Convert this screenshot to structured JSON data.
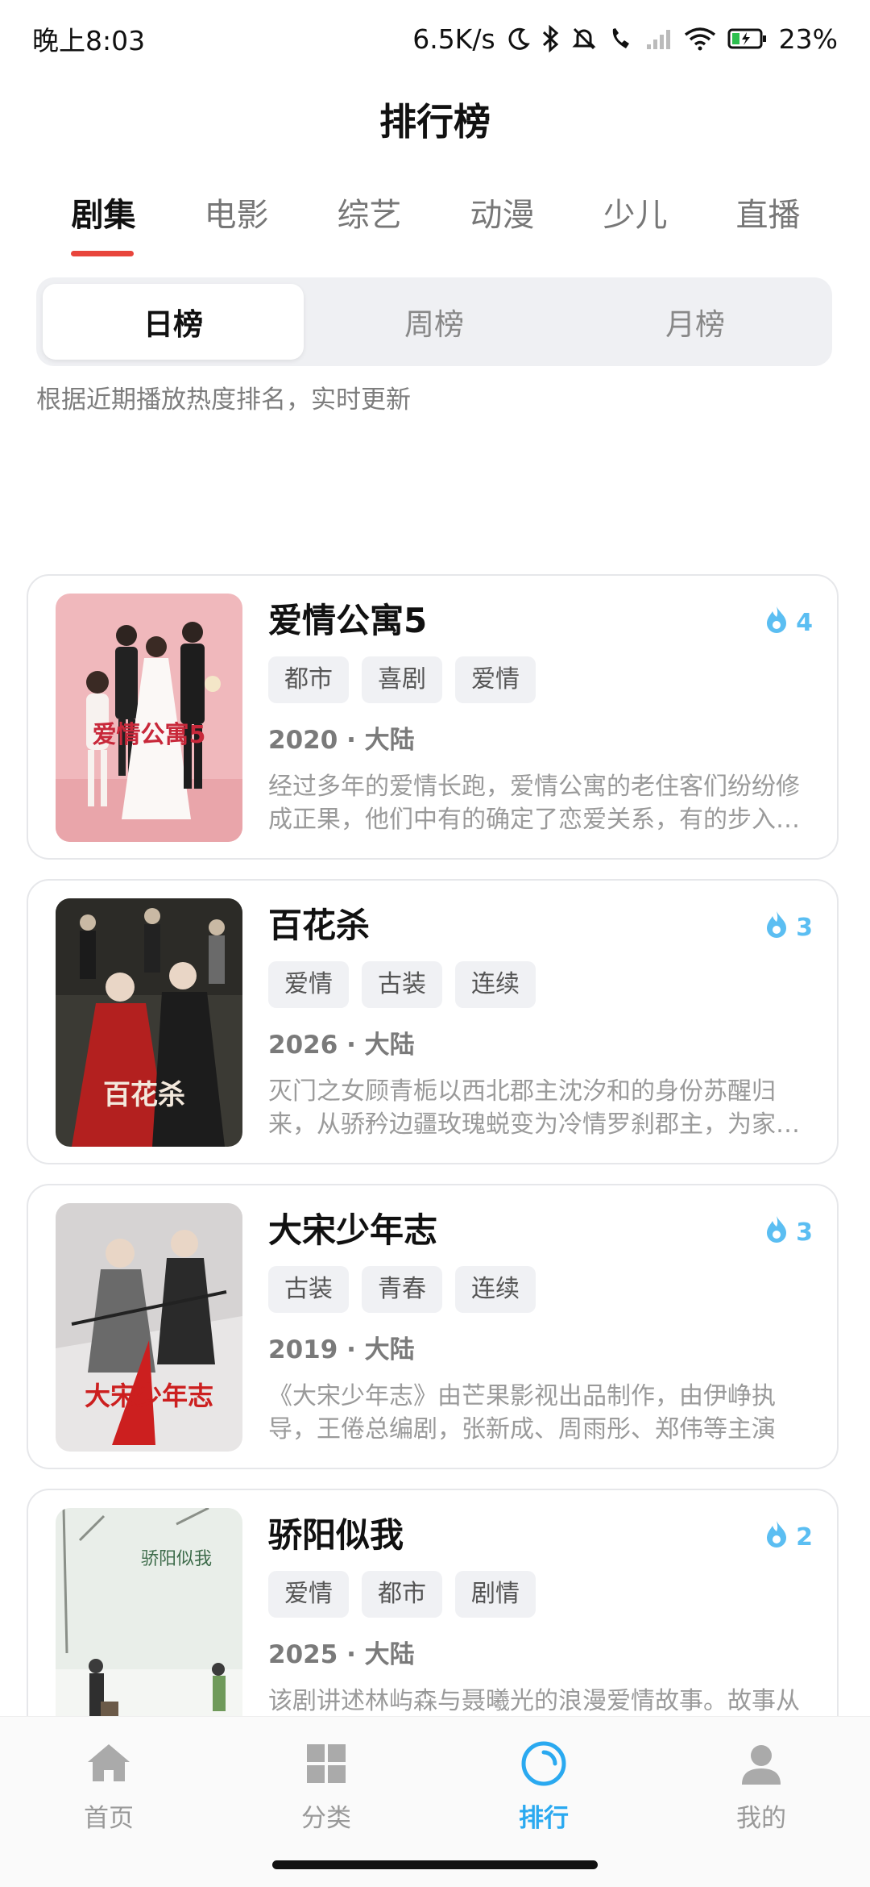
{
  "status_bar": {
    "time": "晚上8:03",
    "net_speed": "6.5K/s",
    "battery": "23%"
  },
  "header": {
    "title": "排行榜"
  },
  "category_tabs": [
    {
      "label": "剧集",
      "active": true
    },
    {
      "label": "电影",
      "active": false
    },
    {
      "label": "综艺",
      "active": false
    },
    {
      "label": "动漫",
      "active": false
    },
    {
      "label": "少儿",
      "active": false
    },
    {
      "label": "直播",
      "active": false
    }
  ],
  "period_tabs": [
    {
      "label": "日榜",
      "active": true
    },
    {
      "label": "周榜",
      "active": false
    },
    {
      "label": "月榜",
      "active": false
    }
  ],
  "subtitle": "根据近期播放热度排名，实时更新",
  "items": [
    {
      "title": "爱情公寓5",
      "heat": "4",
      "tags": [
        "都市",
        "喜剧",
        "爱情"
      ],
      "meta": "2020 · 大陆",
      "desc": "经过多年的爱情长跑，爱情公寓的老住客们纷纷修成正果，他们中有的确定了恋爱关系，有的步入了婚姻殿堂",
      "poster_title": "爱情公寓5",
      "colors": {
        "bg": "#f0b8bc",
        "accent": "#c8283a"
      }
    },
    {
      "title": "百花杀",
      "heat": "3",
      "tags": [
        "爱情",
        "古装",
        "连续"
      ],
      "meta": "2026 · 大陆",
      "desc": "灭门之女顾青栀以西北郡主沈汐和的身份苏醒归来，从骄矜边疆玫瑰蜕变为冷情罗刹郡主，为家族复仇",
      "poster_title": "百花杀",
      "colors": {
        "bg": "#3b3a34",
        "accent": "#b3201f"
      }
    },
    {
      "title": "大宋少年志",
      "heat": "3",
      "tags": [
        "古装",
        "青春",
        "连续"
      ],
      "meta": "2019 · 大陆",
      "desc": "《大宋少年志》由芒果影视出品制作，由伊峥执导，王倦总编剧，张新成、周雨彤、郑伟等主演",
      "poster_title": "大宋少年志",
      "colors": {
        "bg": "#e8e6e6",
        "accent": "#cc1f1f"
      }
    },
    {
      "title": "骄阳似我",
      "heat": "2",
      "tags": [
        "爱情",
        "都市",
        "剧情"
      ],
      "meta": "2025 · 大陆",
      "desc": "该剧讲述林屿森与聂曦光的浪漫爱情故事。故事从一场雪中的重逢开始",
      "poster_title": "骄阳似我",
      "colors": {
        "bg": "#e9eee9",
        "accent": "#3d6b4a"
      }
    }
  ],
  "bottom_nav": [
    {
      "label": "首页",
      "icon": "home-icon",
      "active": false
    },
    {
      "label": "分类",
      "icon": "grid-icon",
      "active": false
    },
    {
      "label": "排行",
      "icon": "ranking-icon",
      "active": true
    },
    {
      "label": "我的",
      "icon": "user-icon",
      "active": false
    }
  ],
  "colors": {
    "tab_indicator": "#e8453c",
    "heat": "#5bbef2",
    "nav_active": "#2aa9f0"
  }
}
